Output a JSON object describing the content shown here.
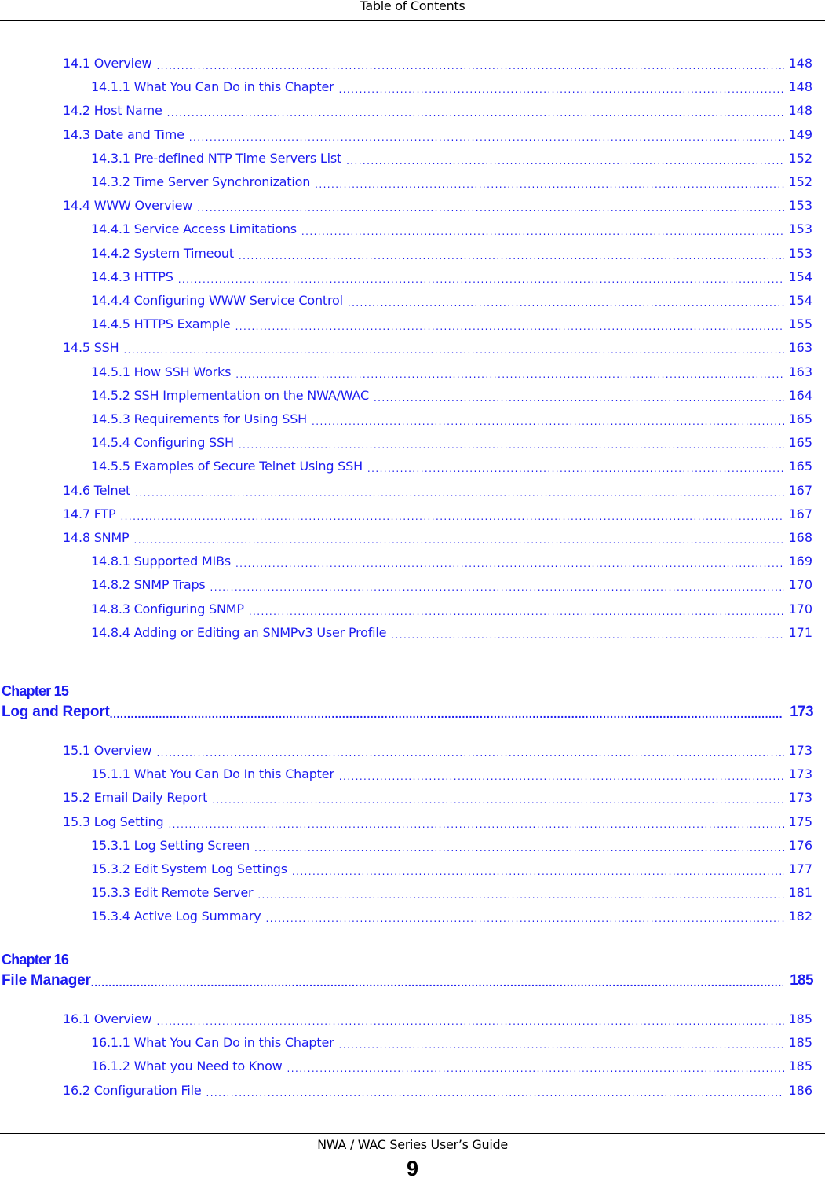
{
  "header": {
    "title": "Table of Contents"
  },
  "footer": {
    "guide_title": "NWA / WAC Series User’s Guide",
    "page_number": "9"
  },
  "colors": {
    "link": "#1c1cf0",
    "text": "#000000"
  },
  "sections": [
    {
      "level": 1,
      "label": "14.1 Overview",
      "page": "148"
    },
    {
      "level": 2,
      "label": "14.1.1 What You Can Do in this Chapter",
      "page": "148"
    },
    {
      "level": 1,
      "label": "14.2 Host Name",
      "page": "148"
    },
    {
      "level": 1,
      "label": "14.3 Date and Time",
      "page": "149"
    },
    {
      "level": 2,
      "label": "14.3.1 Pre-defined NTP Time Servers List",
      "page": "152"
    },
    {
      "level": 2,
      "label": "14.3.2 Time Server Synchronization",
      "page": "152"
    },
    {
      "level": 1,
      "label": "14.4 WWW Overview",
      "page": "153"
    },
    {
      "level": 2,
      "label": "14.4.1 Service Access Limitations",
      "page": "153"
    },
    {
      "level": 2,
      "label": "14.4.2 System Timeout",
      "page": "153"
    },
    {
      "level": 2,
      "label": "14.4.3 HTTPS",
      "page": "154"
    },
    {
      "level": 2,
      "label": "14.4.4 Configuring WWW Service Control",
      "page": "154"
    },
    {
      "level": 2,
      "label": "14.4.5 HTTPS Example",
      "page": "155"
    },
    {
      "level": 1,
      "label": "14.5 SSH",
      "page": "163"
    },
    {
      "level": 2,
      "label": "14.5.1 How SSH Works",
      "page": "163"
    },
    {
      "level": 2,
      "label": "14.5.2 SSH Implementation on the NWA/WAC",
      "page": "164"
    },
    {
      "level": 2,
      "label": "14.5.3 Requirements for Using SSH",
      "page": "165"
    },
    {
      "level": 2,
      "label": "14.5.4 Configuring SSH",
      "page": "165"
    },
    {
      "level": 2,
      "label": "14.5.5 Examples of Secure Telnet Using SSH",
      "page": "165"
    },
    {
      "level": 1,
      "label": "14.6 Telnet",
      "page": "167"
    },
    {
      "level": 1,
      "label": "14.7 FTP",
      "page": "167"
    },
    {
      "level": 1,
      "label": "14.8 SNMP",
      "page": "168"
    },
    {
      "level": 2,
      "label": "14.8.1 Supported MIBs",
      "page": "169"
    },
    {
      "level": 2,
      "label": "14.8.2 SNMP Traps",
      "page": "170"
    },
    {
      "level": 2,
      "label": "14.8.3 Configuring SNMP",
      "page": "170"
    },
    {
      "level": 2,
      "label": "14.8.4 Adding or Editing an SNMPv3 User Profile",
      "page": "171"
    }
  ],
  "chapters": [
    {
      "number_label": "Chapter 15",
      "title": "Log and Report",
      "page": "173",
      "sections": [
        {
          "level": 1,
          "label": "15.1 Overview",
          "page": "173"
        },
        {
          "level": 2,
          "label": "15.1.1 What You Can Do In this Chapter",
          "page": "173"
        },
        {
          "level": 1,
          "label": "15.2 Email Daily Report",
          "page": "173"
        },
        {
          "level": 1,
          "label": "15.3 Log Setting",
          "page": "175"
        },
        {
          "level": 2,
          "label": "15.3.1 Log Setting Screen",
          "page": "176"
        },
        {
          "level": 2,
          "label": "15.3.2 Edit System Log Settings",
          "page": "177"
        },
        {
          "level": 2,
          "label": "15.3.3 Edit Remote Server",
          "page": "181"
        },
        {
          "level": 2,
          "label": "15.3.4 Active Log Summary",
          "page": "182"
        }
      ]
    },
    {
      "number_label": "Chapter 16",
      "title": "File Manager",
      "page": "185",
      "sections": [
        {
          "level": 1,
          "label": "16.1 Overview",
          "page": "185"
        },
        {
          "level": 2,
          "label": "16.1.1 What You Can Do in this Chapter",
          "page": "185"
        },
        {
          "level": 2,
          "label": "16.1.2 What you Need to Know",
          "page": "185"
        },
        {
          "level": 1,
          "label": "16.2 Configuration File",
          "page": "186"
        }
      ]
    }
  ]
}
